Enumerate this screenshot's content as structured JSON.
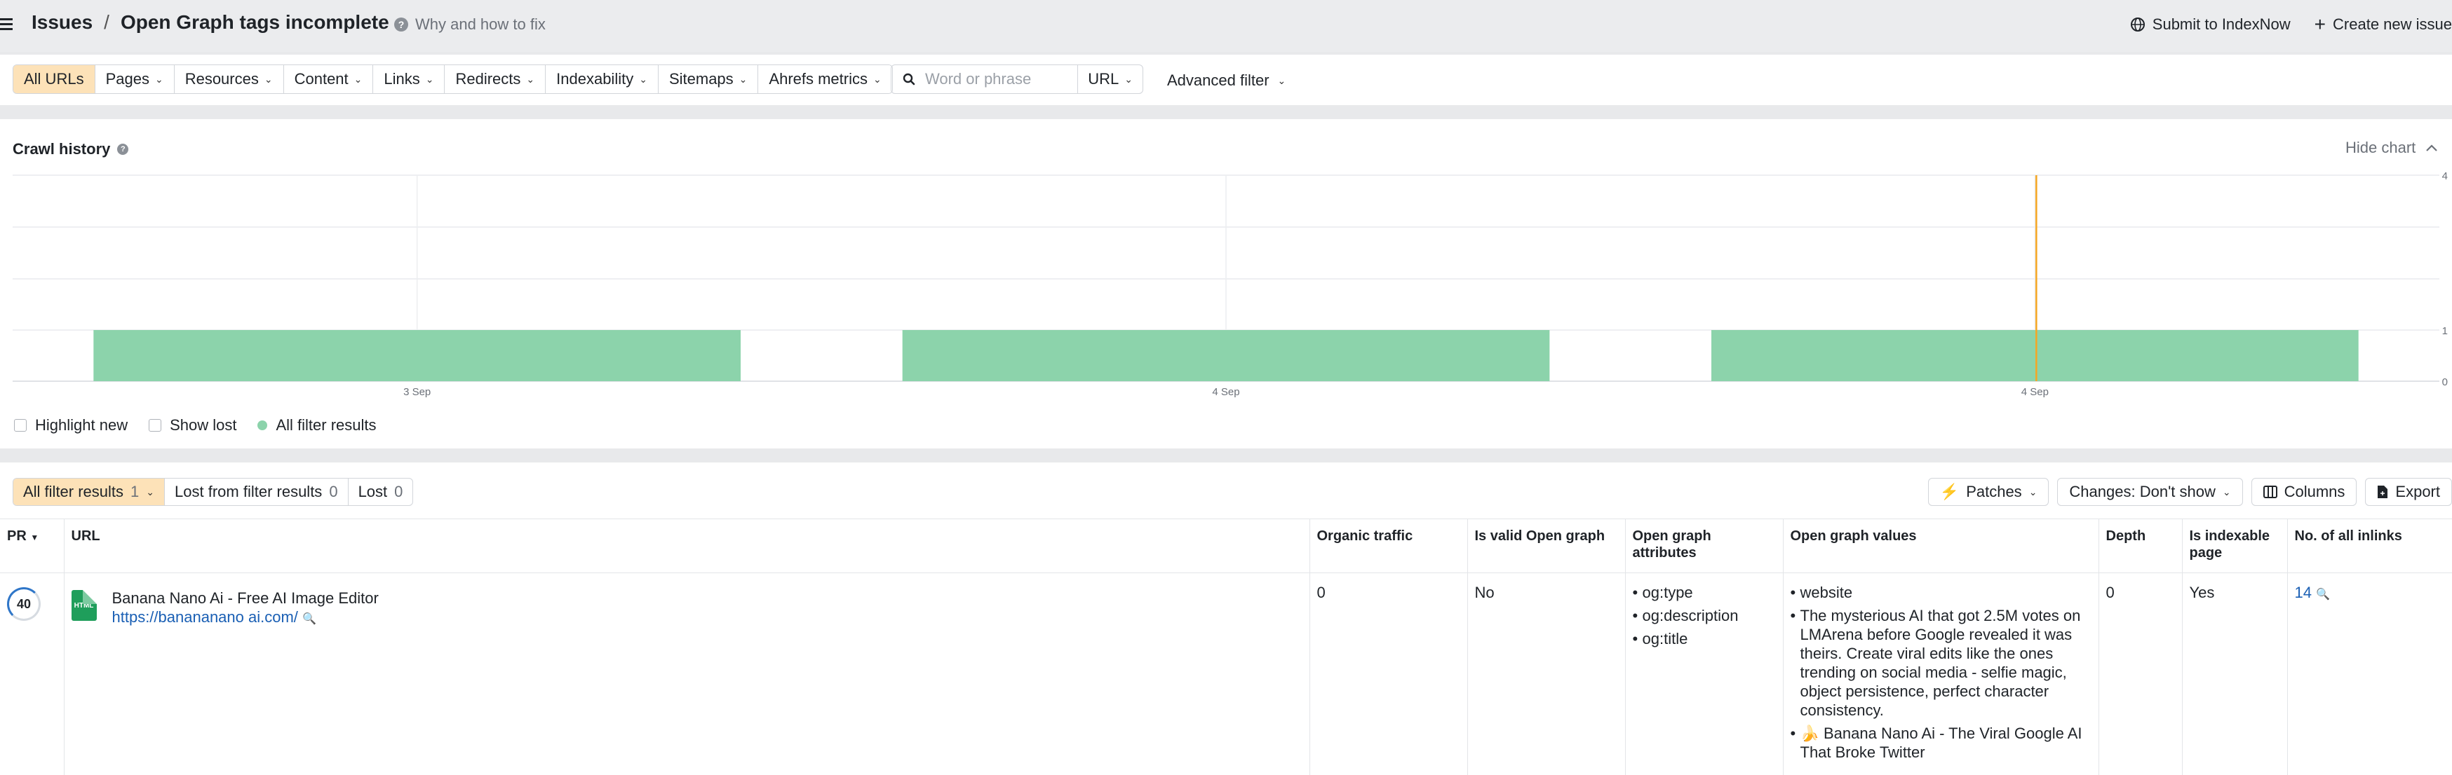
{
  "header": {
    "breadcrumb_root": "Issues",
    "breadcrumb_separator": "/",
    "page_title": "Open Graph tags incomplete",
    "help_link": "Why and how to fix",
    "submit_indexnow": "Submit to IndexNow",
    "create_issue": "Create new issue"
  },
  "filters": {
    "items": [
      "All URLs",
      "Pages",
      "Resources",
      "Content",
      "Links",
      "Redirects",
      "Indexability",
      "Sitemaps",
      "Ahrefs metrics"
    ],
    "active": "All URLs",
    "search_placeholder": "Word or phrase",
    "search_value": "",
    "search_scope": "URL",
    "advanced_filter": "Advanced filter"
  },
  "crawl_history": {
    "title": "Crawl history",
    "hide_chart": "Hide chart",
    "legend": {
      "highlight_new": "Highlight new",
      "show_lost": "Show lost",
      "all_filter_results": "All filter results"
    }
  },
  "chart_data": {
    "type": "bar",
    "categories": [
      "3 Sep",
      "4 Sep",
      "4 Sep"
    ],
    "series": [
      {
        "name": "All filter results",
        "values": [
          1,
          1,
          1
        ],
        "color": "#8cd3ab"
      }
    ],
    "y_ticks": [
      "0",
      "1",
      "4"
    ],
    "ylim": [
      0,
      4
    ],
    "marker_category_index": 2,
    "marker_color": "#f5a623",
    "grid": true
  },
  "results": {
    "tabs": [
      {
        "label": "All filter results",
        "count": "1"
      },
      {
        "label": "Lost from filter results",
        "count": "0"
      },
      {
        "label": "Lost",
        "count": "0"
      }
    ],
    "actions": {
      "patches": "Patches",
      "changes": "Changes: Don't show",
      "columns": "Columns",
      "export": "Export"
    },
    "columns": {
      "pr": "PR",
      "url": "URL",
      "organic_traffic": "Organic traffic",
      "is_valid_og": "Is valid Open graph",
      "og_attributes": "Open graph attributes",
      "og_values": "Open graph values",
      "depth": "Depth",
      "is_indexable": "Is indexable page",
      "inlinks": "No. of all inlinks"
    },
    "rows": [
      {
        "pr": "40",
        "file_type": "HTML",
        "title": "Banana Nano Ai - Free AI Image Editor",
        "url": "https://banananano ai.com/",
        "organic_traffic": "0",
        "is_valid_og": "No",
        "og_attributes": [
          "og:type",
          "og:description",
          "og:title"
        ],
        "og_values": [
          "website",
          "The mysterious AI that got 2.5M votes on LMArena before Google revealed it was theirs. Create viral edits like the ones trending on social media - selfie magic, object persistence, perfect character consistency.",
          "🍌 Banana Nano Ai - The Viral Google AI That Broke Twitter"
        ],
        "depth": "0",
        "is_indexable": "Yes",
        "inlinks": "14"
      }
    ]
  }
}
